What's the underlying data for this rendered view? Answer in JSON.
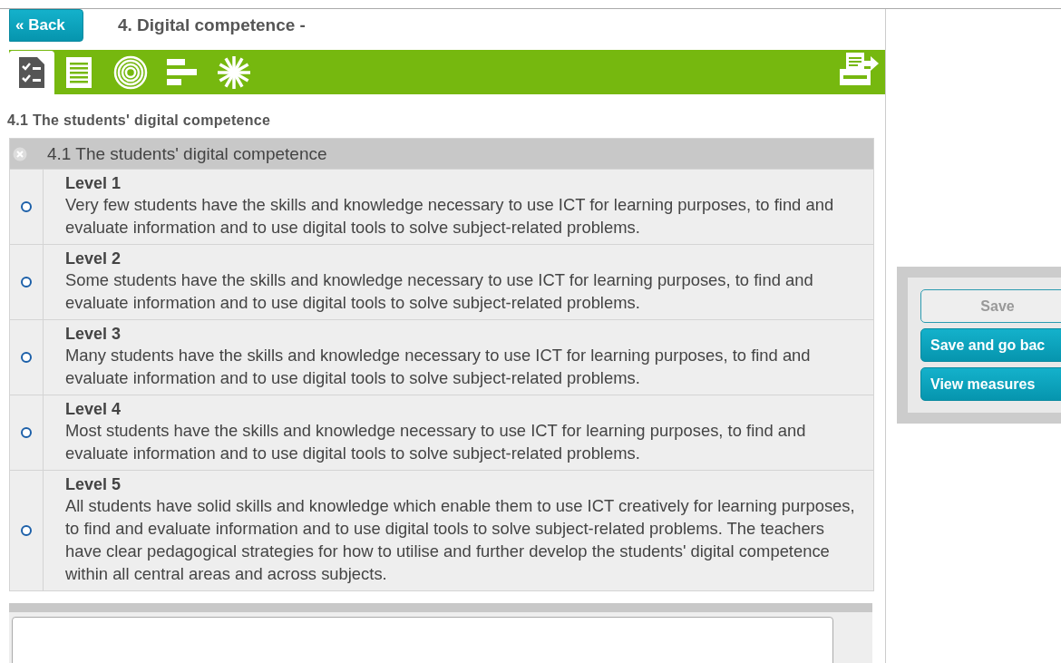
{
  "header": {
    "back_button": "« Back",
    "title": "4. Digital competence -"
  },
  "toolbar": {
    "tabs": [
      {
        "kind": "checklist",
        "selected": true
      },
      {
        "kind": "document",
        "selected": false
      },
      {
        "kind": "target",
        "selected": false
      },
      {
        "kind": "bars",
        "selected": false
      },
      {
        "kind": "burst",
        "selected": false
      }
    ]
  },
  "section_heading": "4.1 The students' digital competence",
  "criteria": {
    "title": "4.1 The students' digital competence",
    "levels": [
      {
        "label": "Level 1",
        "description": "Very few students have the skills and knowledge necessary to use ICT for learning purposes, to find and evaluate information and to use digital tools to solve subject-related problems.",
        "selected": false
      },
      {
        "label": "Level 2",
        "description": "Some students have the skills and knowledge necessary to use ICT for learning purposes, to find and evaluate information and to use digital tools to solve subject-related problems.",
        "selected": false
      },
      {
        "label": "Level 3",
        "description": "Many students have the skills and knowledge necessary to use ICT for learning purposes, to find and evaluate information and to use digital tools to solve subject-related problems.",
        "selected": false
      },
      {
        "label": "Level 4",
        "description": "Most students have the skills and knowledge necessary to use ICT for learning purposes, to find and evaluate information and to use digital tools to solve subject-related problems.",
        "selected": false
      },
      {
        "label": "Level 5",
        "description": "All students have solid skills and knowledge which enable them to use ICT creatively for learning purposes, to find and evaluate information and to use digital tools to solve subject-related problems. The teachers have clear pedagogical strategies for how to utilise and further develop the students' digital competence within all central areas and across subjects.",
        "selected": false
      }
    ]
  },
  "actions": [
    {
      "label": "Save",
      "disabled": true
    },
    {
      "label": "Save and go bac",
      "disabled": false
    },
    {
      "label": "View measures",
      "disabled": false
    }
  ]
}
